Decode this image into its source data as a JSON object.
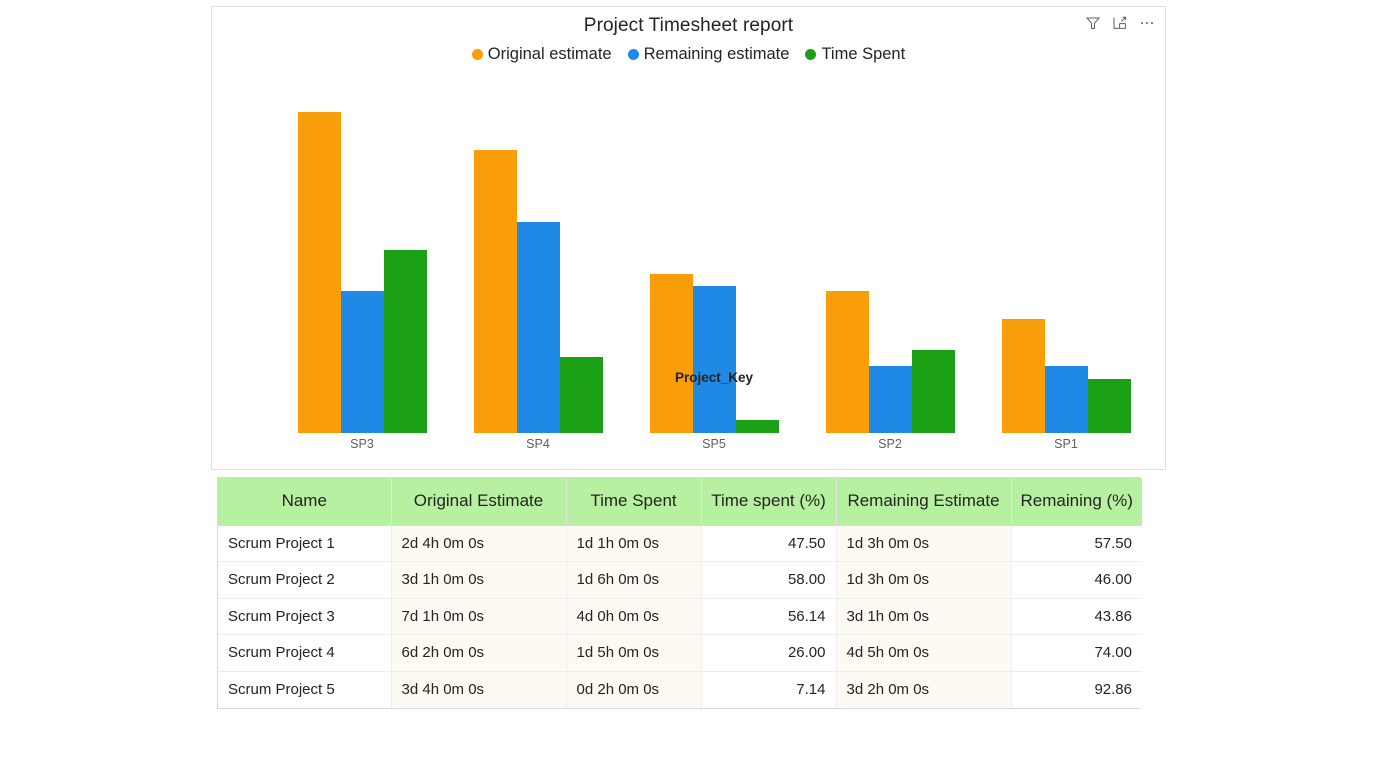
{
  "card": {
    "title": "Project Timesheet report",
    "icons": [
      {
        "name": "filter-icon",
        "label": "Filters"
      },
      {
        "name": "focus-mode-icon",
        "label": "Focus mode"
      },
      {
        "name": "more-options-icon",
        "label": "More options"
      }
    ]
  },
  "colors": {
    "original_estimate": "#f99d09",
    "remaining_estimate": "#1f8ae5",
    "time_spent": "#1ba015",
    "header_background": "#b7f0a0",
    "row_tint": "#fdf9f3",
    "card_border": "#e0e0e0"
  },
  "chart_data": {
    "type": "bar",
    "title": "Project Timesheet report",
    "xlabel": "Project_Key",
    "ylabel": "",
    "grid": false,
    "legend_position": "top",
    "categories": [
      "SP3",
      "SP4",
      "SP5",
      "SP2",
      "SP1"
    ],
    "ylim": [
      0,
      336
    ],
    "series": [
      {
        "name": "Original estimate",
        "color": "#f99d09",
        "values": [
          320,
          282,
          159,
          142,
          114
        ]
      },
      {
        "name": "Remaining estimate",
        "color": "#1f8ae5",
        "values": [
          142,
          210,
          147,
          67,
          67
        ]
      },
      {
        "name": "Time Spent",
        "color": "#1ba015",
        "values": [
          182,
          76,
          13,
          83,
          54
        ]
      }
    ]
  },
  "table": {
    "columns": [
      "Name",
      "Original Estimate",
      "Time Spent",
      "Time spent (%)",
      "Remaining Estimate",
      "Remaining (%)"
    ],
    "rows": [
      {
        "name": "Scrum Project 1",
        "original_estimate": "2d 4h 0m 0s",
        "time_spent": "1d 1h 0m 0s",
        "time_spent_pct": "47.50",
        "remaining_estimate": "1d 3h 0m 0s",
        "remaining_pct": "57.50"
      },
      {
        "name": "Scrum Project 2",
        "original_estimate": "3d 1h 0m 0s",
        "time_spent": "1d 6h 0m 0s",
        "time_spent_pct": "58.00",
        "remaining_estimate": "1d 3h 0m 0s",
        "remaining_pct": "46.00"
      },
      {
        "name": "Scrum Project 3",
        "original_estimate": "7d 1h 0m 0s",
        "time_spent": "4d 0h 0m 0s",
        "time_spent_pct": "56.14",
        "remaining_estimate": "3d 1h 0m 0s",
        "remaining_pct": "43.86"
      },
      {
        "name": "Scrum Project 4",
        "original_estimate": "6d 2h 0m 0s",
        "time_spent": "1d 5h 0m 0s",
        "time_spent_pct": "26.00",
        "remaining_estimate": "4d 5h 0m 0s",
        "remaining_pct": "74.00"
      },
      {
        "name": "Scrum Project 5",
        "original_estimate": "3d 4h 0m 0s",
        "time_spent": "0d 2h 0m 0s",
        "time_spent_pct": "7.14",
        "remaining_estimate": "3d 2h 0m 0s",
        "remaining_pct": "92.86"
      }
    ]
  }
}
